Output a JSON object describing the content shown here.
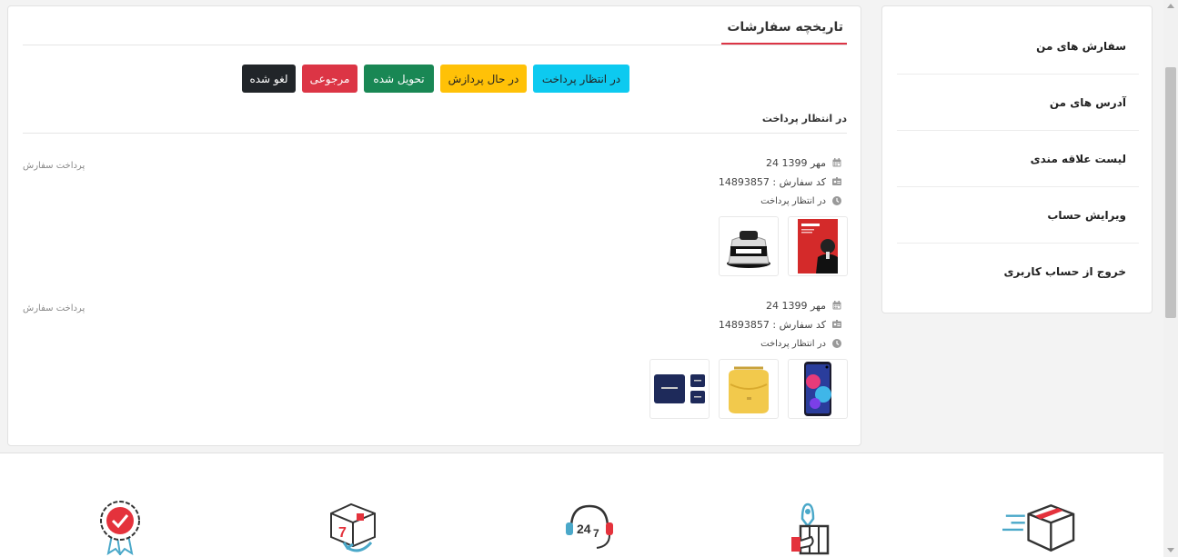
{
  "header": {
    "title": "تاریخچه سفارشات"
  },
  "status_buttons": [
    {
      "label": "در انتظار پرداخت",
      "bg": "#0dcaf0",
      "color": "#222"
    },
    {
      "label": "در حال پردازش",
      "bg": "#ffc107",
      "color": "#222"
    },
    {
      "label": "تحویل شده",
      "bg": "#198754",
      "color": "#ffffff"
    },
    {
      "label": "مرجوعی",
      "bg": "#dc3545",
      "color": "#ffffff"
    },
    {
      "label": "لغو شده",
      "bg": "#212529",
      "color": "#ffffff"
    }
  ],
  "section": {
    "heading": "در انتظار پرداخت"
  },
  "orders": [
    {
      "date": "24 مهر 1399",
      "code_label": "کد سفارش : 14893857",
      "status": "در انتظار پرداخت",
      "pay_label": "پرداخت سفارش",
      "thumbs": [
        "book-cover",
        "knife-sharpener"
      ]
    },
    {
      "date": "24 مهر 1399",
      "code_label": "کد سفارش : 14893857",
      "status": "در انتظار پرداخت",
      "pay_label": "پرداخت سفارش",
      "thumbs": [
        "smartphone",
        "yellow-bag",
        "navy-wallet"
      ]
    }
  ],
  "sidebar": {
    "items": [
      {
        "label": "سفارش های من"
      },
      {
        "label": "آدرس های من"
      },
      {
        "label": "لیست علاقه مندی"
      },
      {
        "label": "ویرایش حساب"
      },
      {
        "label": "خروج از حساب کاربری"
      }
    ]
  },
  "footer": {
    "features": [
      "quality-badge-icon",
      "seven-day-return-icon",
      "support-24-7-icon",
      "cash-on-delivery-icon",
      "fast-delivery-icon"
    ]
  },
  "colors": {
    "accent": "#dc3545"
  }
}
